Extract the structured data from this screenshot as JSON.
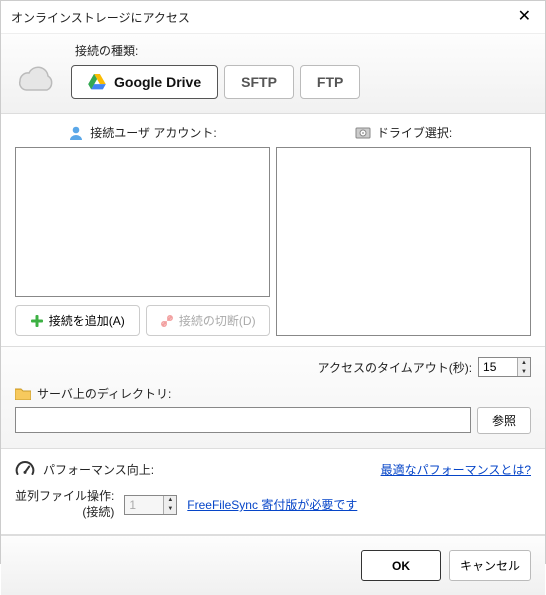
{
  "title": "オンラインストレージにアクセス",
  "connection": {
    "label": "接続の種類:",
    "tabs": {
      "gdrive": "Google Drive",
      "sftp": "SFTP",
      "ftp": "FTP"
    }
  },
  "accounts": {
    "header": "接続ユーザ アカウント:",
    "add_button": "接続を追加(A)",
    "disconnect_button": "接続の切断(D)"
  },
  "drive": {
    "header": "ドライブ選択:"
  },
  "timeout": {
    "label": "アクセスのタイムアウト(秒):",
    "value": "15"
  },
  "directory": {
    "label": "サーバ上のディレクトリ:",
    "value": "",
    "browse": "参照"
  },
  "performance": {
    "header": "パフォーマンス向上:",
    "help_link": "最適なパフォーマンスとは?",
    "parallel_label_line1": "並列ファイル操作:",
    "parallel_label_line2": "(接続)",
    "parallel_value": "1",
    "donation_link": "FreeFileSync 寄付版が必要です"
  },
  "footer": {
    "ok": "OK",
    "cancel": "キャンセル"
  }
}
